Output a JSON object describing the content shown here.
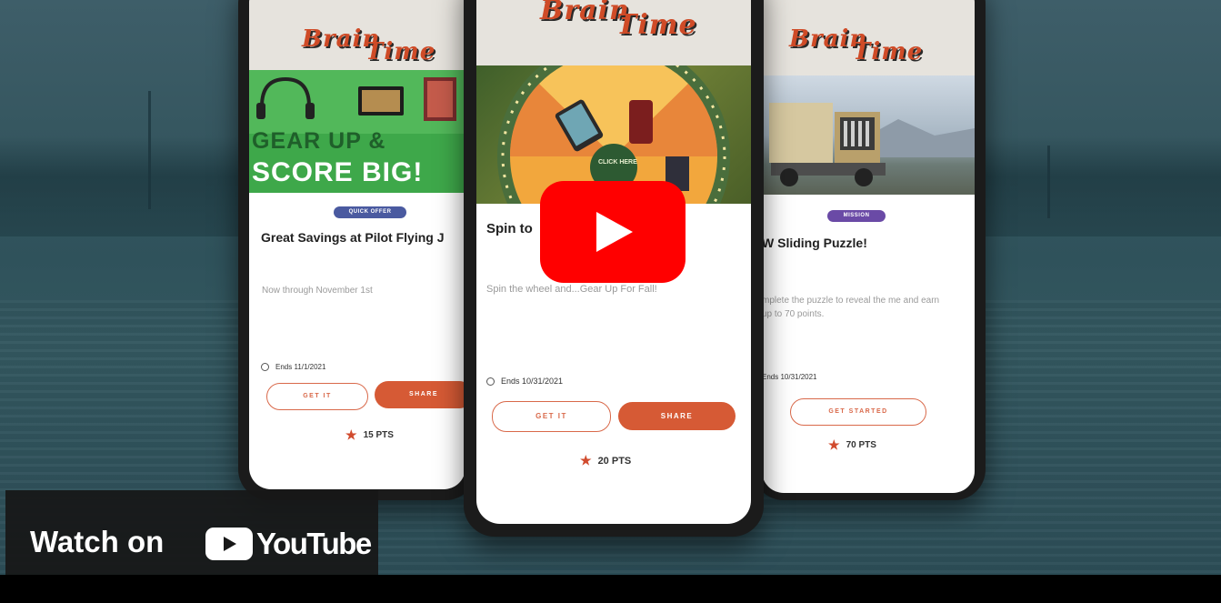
{
  "video": {
    "watch_on": "Watch on",
    "youtube_wordmark": "YouTube",
    "play_icon": "youtube-play-icon",
    "colors": {
      "youtube_red": "#ff0000",
      "overlay": "#171717"
    }
  },
  "app": {
    "logo_line1": "Brain",
    "logo_line2": "Time",
    "accent_color": "#d65a35"
  },
  "cards": [
    {
      "badge": "QUICK OFFER",
      "badge_color": "#4a5aa0",
      "promo_text_1": "GEAR UP &",
      "promo_text_2": "SCORE BIG!",
      "title": "Great Savings at Pilot Flying J",
      "description": "Now through November 1st",
      "ends": "Ends 11/1/2021",
      "primary_action": "GET IT",
      "secondary_action": "SHARE",
      "points": "15 PTS"
    },
    {
      "promo_label": "CLICK HERE",
      "title": "Spin to",
      "description": "Spin the wheel and...Gear Up For Fall!",
      "ends": "Ends 10/31/2021",
      "primary_action": "GET IT",
      "secondary_action": "SHARE",
      "points": "20 PTS"
    },
    {
      "badge": "MISSION",
      "badge_color": "#6a4aa6",
      "title": "W Sliding Puzzle!",
      "description": "mplete the puzzle to reveal the me and earn up to 70 points.",
      "ends": "Ends 10/31/2021",
      "primary_action": "GET STARTED",
      "points": "70 PTS"
    }
  ]
}
